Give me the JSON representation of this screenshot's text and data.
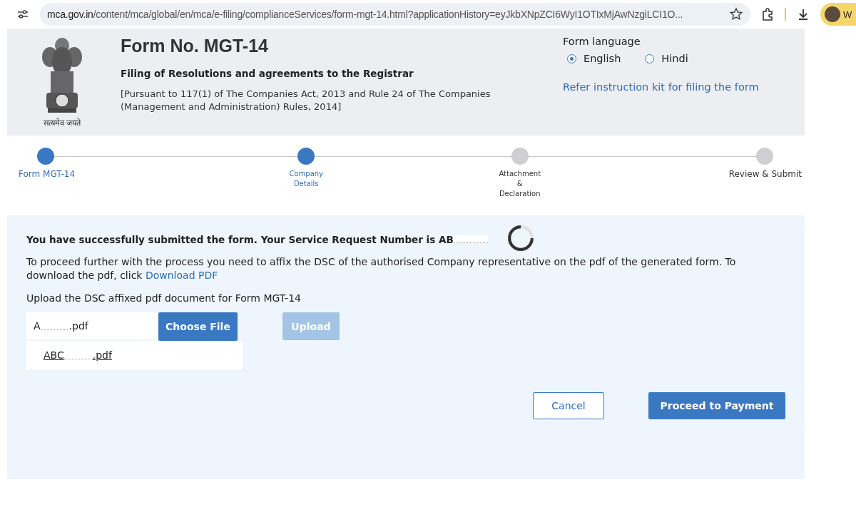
{
  "browser": {
    "url_host": "mca.gov.in",
    "url_path": "/content/mca/global/en/mca/e-filing/complianceServices/form-mgt-14.html?applicationHistory=eyJkbXNpZCI6WyI1OTIxMjAwNzgiLCI1O...",
    "profile_initial": "W"
  },
  "header": {
    "emblem_motto": "सत्यमेव जयते",
    "title": "Form No. MGT-14",
    "subtitle": "Filing of Resolutions and agreements to the Registrar",
    "note": "[Pursuant to 117(1) of The Companies Act, 2013 and Rule 24 of The Companies (Management and Administration) Rules, 2014]",
    "language_label": "Form language",
    "languages": [
      {
        "label": "English",
        "selected": true
      },
      {
        "label": "Hindi",
        "selected": false
      }
    ],
    "instruction_link": "Refer instruction kit for filing the form"
  },
  "steps": [
    {
      "label": "Form MGT-14",
      "done": true
    },
    {
      "label": "Company Details",
      "done": true
    },
    {
      "label": "Attachment & Declaration",
      "done": false
    },
    {
      "label": "Review & Submit",
      "done": false
    }
  ],
  "panel": {
    "success": "You have successfully submitted the form. Your Service Request Number is AB",
    "instruction": "To proceed further with the process you need to affix the DSC of the authorised Company representative on the pdf of the generated form. To download the pdf, click",
    "download_link": "Download PDF",
    "upload_label": "Upload the DSC affixed pdf document for Form MGT-14",
    "file_prefix": "A",
    "file_suffix": ".pdf",
    "choose_button": "Choose File",
    "upload_button": "Upload",
    "upload_disabled": true,
    "file_link_prefix": "ABC",
    "file_link_suffix": ".pdf",
    "cancel_button": "Cancel",
    "proceed_button": "Proceed to Payment"
  }
}
